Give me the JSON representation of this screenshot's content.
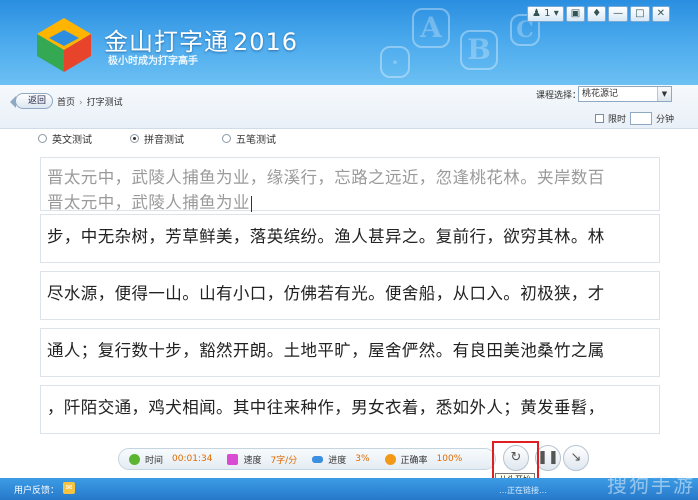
{
  "app": {
    "brand": "金山打字通",
    "year": "2016",
    "slogan": "极小时成为打字高手"
  },
  "topbar": {
    "user_count": "1",
    "buttons": [
      "user-icon",
      "skin-icon",
      "shirt-icon",
      "minimize-icon",
      "maximize-icon",
      "close-icon"
    ]
  },
  "nav": {
    "back_label": "返回",
    "breadcrumb": [
      "首页",
      "打字测试"
    ],
    "breadcrumb_sep": "›",
    "course_label": "课程选择：",
    "course_value": "桃花源记",
    "time_limit_label": "限时",
    "time_limit_unit": "分钟"
  },
  "modes": [
    {
      "label": "英文测试",
      "selected": false
    },
    {
      "label": "拼音测试",
      "selected": true
    },
    {
      "label": "五笔测试",
      "selected": false
    }
  ],
  "lines": [
    {
      "text": "晋太元中，武陵人捕鱼为业，缘溪行，忘路之远近，忽逢桃花林。夹岸数百",
      "typed": "晋太元中，武陵人捕鱼为业",
      "typed_chars": 12
    },
    {
      "text": "步，中无杂树，芳草鲜美，落英缤纷。渔人甚异之。复前行，欲穷其林。林"
    },
    {
      "text": "尽水源，便得一山。山有小口，仿佛若有光。便舍船，从口入。初极狭，才"
    },
    {
      "text": "通人；复行数十步，豁然开朗。土地平旷，屋舍俨然。有良田美池桑竹之属"
    },
    {
      "text": "，阡陌交通，鸡犬相闻。其中往来种作，男女衣着，悉如外人；黄发垂髫，"
    }
  ],
  "stats": {
    "time_label": "时间",
    "time_value": "00:01:34",
    "speed_label": "速度",
    "speed_value": "7字/分",
    "progress_label": "进度",
    "progress_value": "3%",
    "accuracy_label": "正确率",
    "accuracy_value": "100%"
  },
  "controls": {
    "restart_tooltip": "从头开始"
  },
  "footer": {
    "feedback_label": "用户反馈：",
    "faded_text": "…正在链接…",
    "watermark": "搜狗手游"
  },
  "colors": {
    "header_blue": "#3a9ae6",
    "accent_orange": "#e06a00",
    "highlight_red": "#e02020"
  }
}
